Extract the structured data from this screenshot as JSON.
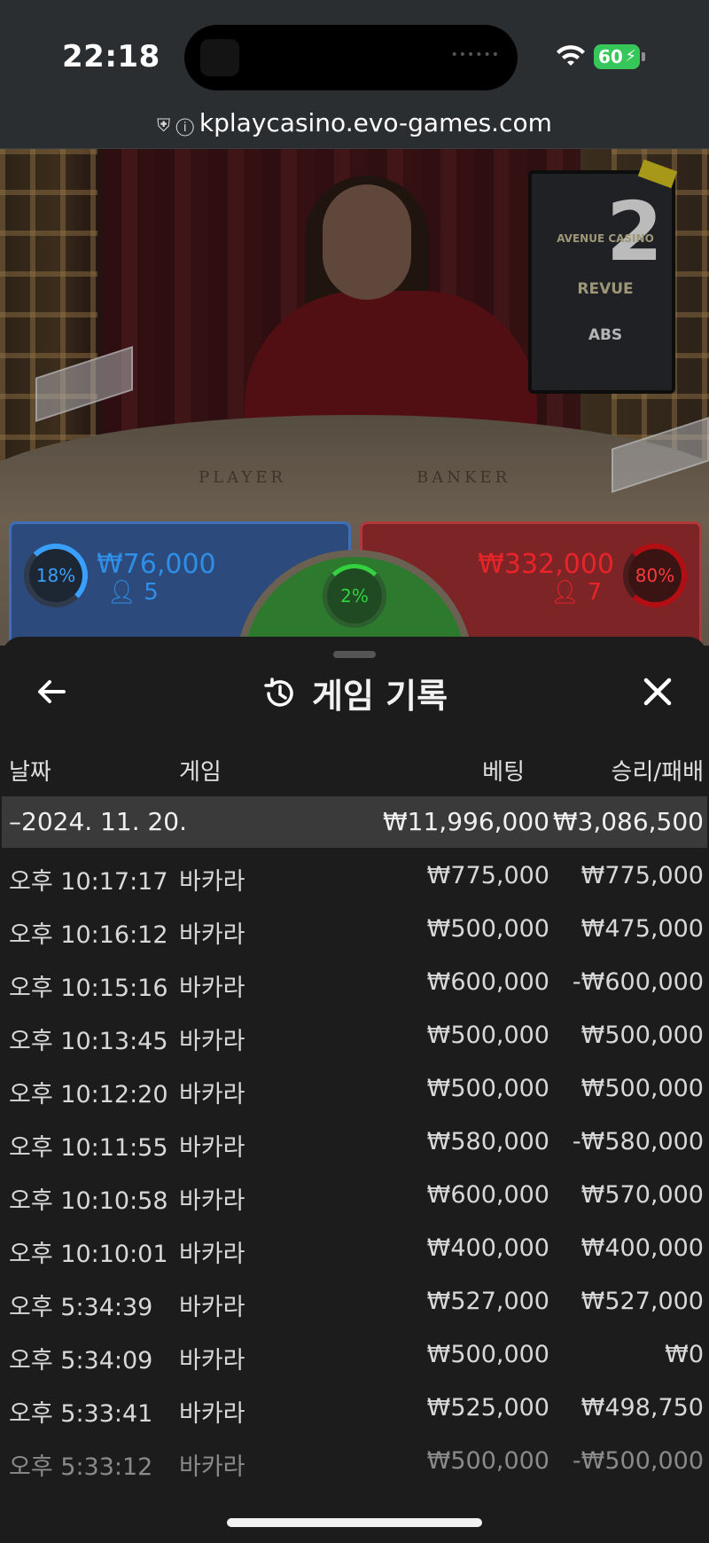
{
  "status": {
    "time": "22:18",
    "battery": "60",
    "url": "kplaycasino.evo-games.com"
  },
  "stream": {
    "promo_number": "2",
    "promo_brands": [
      "AVENUE CASINO",
      "REVUE",
      "ABS"
    ],
    "felt_player": "PLAYER",
    "felt_banker": "BANKER"
  },
  "bets": {
    "player_percent": "18%",
    "player_amount": "₩76,000",
    "player_count": "5",
    "tie_percent": "2%",
    "banker_percent": "80%",
    "banker_amount": "₩332,000",
    "banker_count": "7",
    "colors": {
      "player": "#2c4a7b",
      "banker": "#7c2426",
      "tie": "#2d7a2f"
    }
  },
  "history": {
    "title": "게임 기록",
    "icons": {
      "back": "arrow-left-icon",
      "title": "history-icon",
      "close": "close-icon"
    },
    "columns": {
      "date": "날짜",
      "game": "게임",
      "bet": "베팅",
      "win_loss": "승리/패배"
    },
    "day": {
      "label": "–2024. 11. 20.",
      "bet_total": "₩11,996,000",
      "win_total": "₩3,086,500"
    },
    "rows": [
      {
        "time": "오후 10:17:17",
        "game": "바카라",
        "bet": "₩775,000",
        "result": "₩775,000"
      },
      {
        "time": "오후 10:16:12",
        "game": "바카라",
        "bet": "₩500,000",
        "result": "₩475,000"
      },
      {
        "time": "오후 10:15:16",
        "game": "바카라",
        "bet": "₩600,000",
        "result": "-₩600,000"
      },
      {
        "time": "오후 10:13:45",
        "game": "바카라",
        "bet": "₩500,000",
        "result": "₩500,000"
      },
      {
        "time": "오후 10:12:20",
        "game": "바카라",
        "bet": "₩500,000",
        "result": "₩500,000"
      },
      {
        "time": "오후 10:11:55",
        "game": "바카라",
        "bet": "₩580,000",
        "result": "-₩580,000"
      },
      {
        "time": "오후 10:10:58",
        "game": "바카라",
        "bet": "₩600,000",
        "result": "₩570,000"
      },
      {
        "time": "오후 10:10:01",
        "game": "바카라",
        "bet": "₩400,000",
        "result": "₩400,000"
      },
      {
        "time": "오후 5:34:39",
        "game": "바카라",
        "bet": "₩527,000",
        "result": "₩527,000"
      },
      {
        "time": "오후 5:34:09",
        "game": "바카라",
        "bet": "₩500,000",
        "result": "₩0"
      },
      {
        "time": "오후 5:33:41",
        "game": "바카라",
        "bet": "₩525,000",
        "result": "₩498,750"
      },
      {
        "time": "오후 5:33:12",
        "game": "바카라",
        "bet": "₩500,000",
        "result": "-₩500,000"
      }
    ]
  }
}
